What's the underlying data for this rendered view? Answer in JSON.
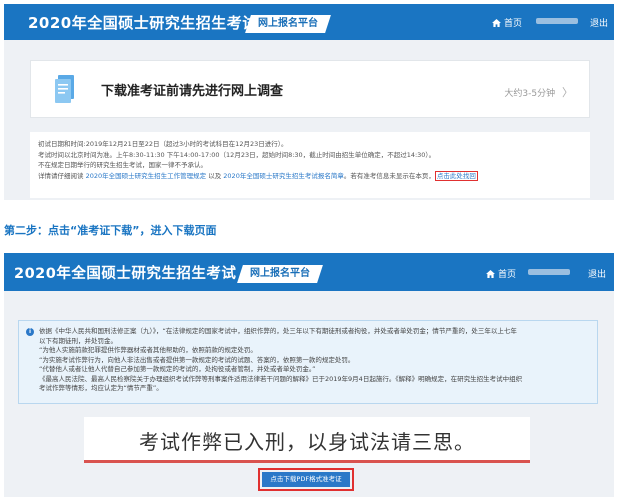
{
  "header": {
    "title": "2020年全国硕士研究生招生考试",
    "platform_tag": "网上报名平台",
    "home_label": "首页",
    "logout_label": "退出"
  },
  "survey": {
    "title": "下载准考证前请先进行网上调查",
    "time_hint": "大约3-5分钟",
    "arrow": "〉"
  },
  "notes": {
    "line1": "初试日期和时间:2019年12月21日至22日（超过3小时的考试科目在12月23日进行）。",
    "line2": "考试时间以北京时间为准。上午8:30-11:30 下午14:00-17:00（12月23日，超始时间8:30，截止时间由招生单位确定，不超过14:30）。",
    "line3": "不在规定日期举行的研究生招生考试，国家一律不予承认。",
    "line4_pre": "详情请仔细阅读",
    "line4_link1": "2020年全国硕士研究生招生工作管理规定",
    "line4_mid": "以及",
    "line4_link2": "2020年全国硕士研究生招生考试报名简章",
    "line4_post": "。若有准考信息未显示在本页，",
    "line4_link3": "点击此处找回"
  },
  "step": {
    "text": "第二步：点击“准考证下载”，进入下载页面"
  },
  "warning": {
    "icon": "i",
    "lines": [
      "依据《中华人民共和国刑法修正案（九）》，“在法律规定的国家考试中，组织作弊的，处三年以下有期徒刑或者拘役，并处或者单处罚金；情节严重的，处三年以上七年",
      "以下有期徒刑，并处罚金。",
      "“为他人实施前款犯罪提供作弊器材或者其他帮助的，依照前款的规定处罚。",
      "“为实施考试作弊行为，向他人非法出售或者提供第一款规定的考试的试题、答案的，依照第一款的规定处罚。",
      "“代替他人或者让他人代替自己参加第一款规定的考试的，处拘役或者管制，并处或者单处罚金。”",
      "《最高人民法院、最高人民检察院关于办理组织考试作弊等刑事案件适用法律若干问题的解释》已于2019年9月4日起施行。《解释》明确规定，在研究生招生考试中组织",
      "考试作弊等情形，均应认定为“情节严重”。"
    ]
  },
  "slogan": "考试作弊已入刑，以身试法请三思。",
  "download_button": "点击下载PDF格式准考证",
  "colors": {
    "header_blue": "#1a75c2",
    "link_blue": "#2a78c8",
    "highlight_red": "#e03030"
  }
}
